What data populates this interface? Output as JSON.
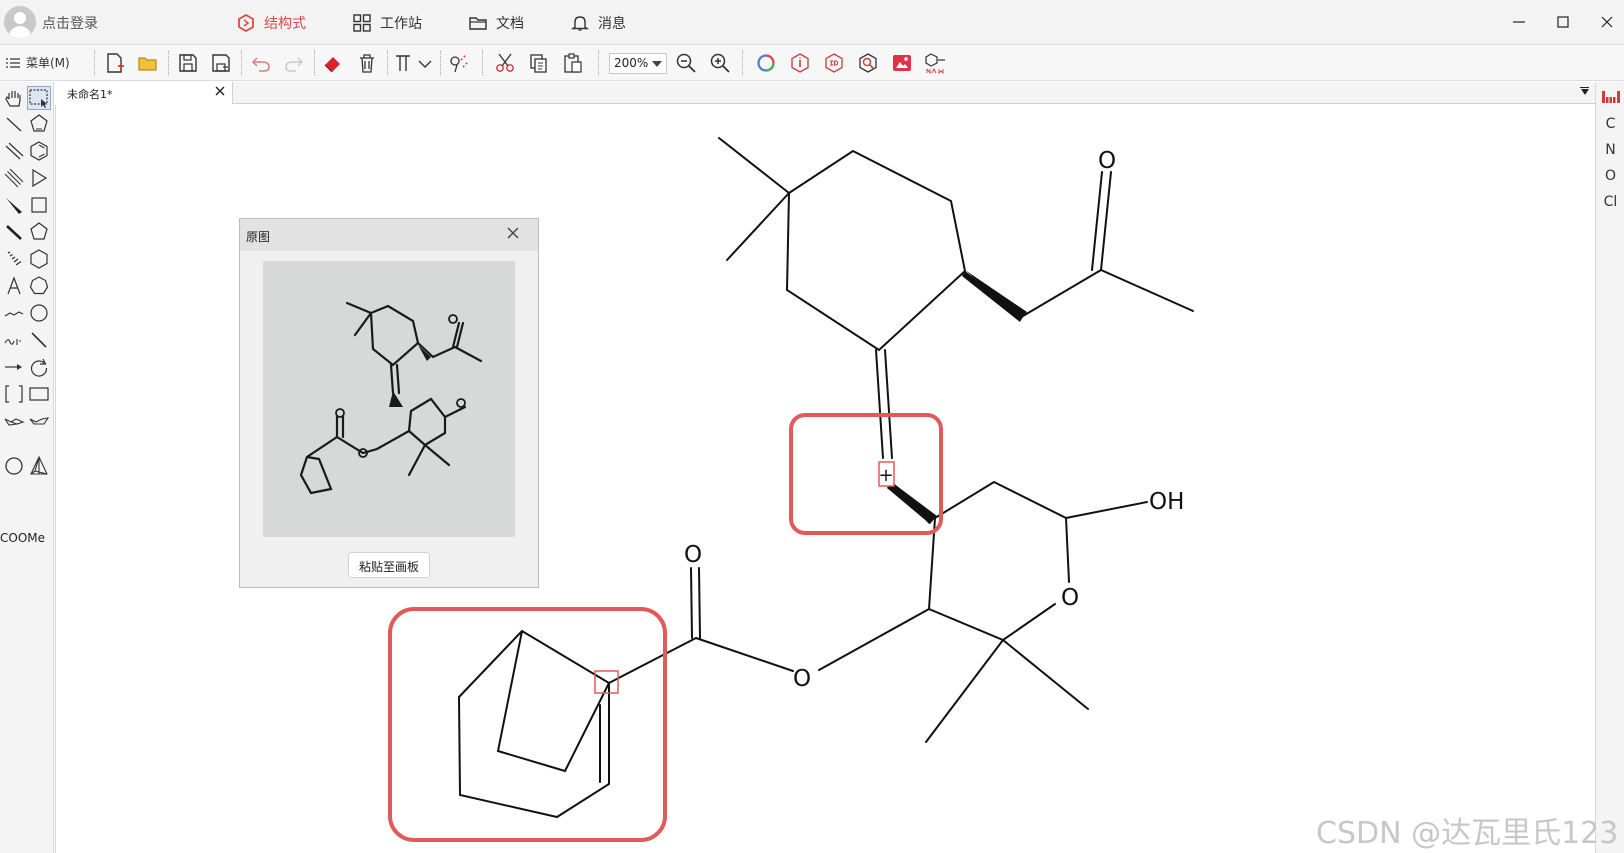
{
  "titlebar": {
    "login_label": "点击登录",
    "tabs": [
      {
        "label": "结构式",
        "icon": "structure-icon",
        "active": true
      },
      {
        "label": "工作站",
        "icon": "grid-icon",
        "active": false
      },
      {
        "label": "文档",
        "icon": "folder-icon",
        "active": false
      },
      {
        "label": "消息",
        "icon": "bell-icon",
        "active": false
      }
    ],
    "window_controls": [
      "minimize-icon",
      "maximize-icon",
      "close-icon"
    ]
  },
  "toolbar": {
    "menu_label": "菜单(M)",
    "zoom_value": "200%",
    "buttons": [
      "new-doc-icon",
      "open-folder-icon",
      "save-icon",
      "save-as-icon",
      "undo-icon",
      "redo-icon",
      "eraser-icon",
      "delete-icon",
      "text-format-icon",
      "chem-check-icon",
      "cut-icon",
      "copy-icon",
      "paste-icon",
      "zoom-out-icon",
      "zoom-in-icon",
      "color-ring-icon",
      "info-icon",
      "3d-icon",
      "search-structure-icon",
      "image-recognize-icon",
      "name-icon"
    ]
  },
  "document": {
    "tab_title": "未命名1*"
  },
  "elements_bar": {
    "items": [
      "C",
      "N",
      "O",
      "Cl"
    ]
  },
  "palette": {
    "coome_label": "COOMe"
  },
  "original_panel": {
    "title": "原图",
    "paste_button_label": "粘贴至画板"
  },
  "molecule": {
    "atom_labels": {
      "ketone_o": "O",
      "ester_carbonyl_o": "O",
      "ester_bridge_o": "O",
      "ring_o": "O",
      "hydroxyl": "OH",
      "plus_marker": "+"
    }
  },
  "annotation_color": "#e05a5a",
  "watermark": "CSDN @达瓦里氏123"
}
